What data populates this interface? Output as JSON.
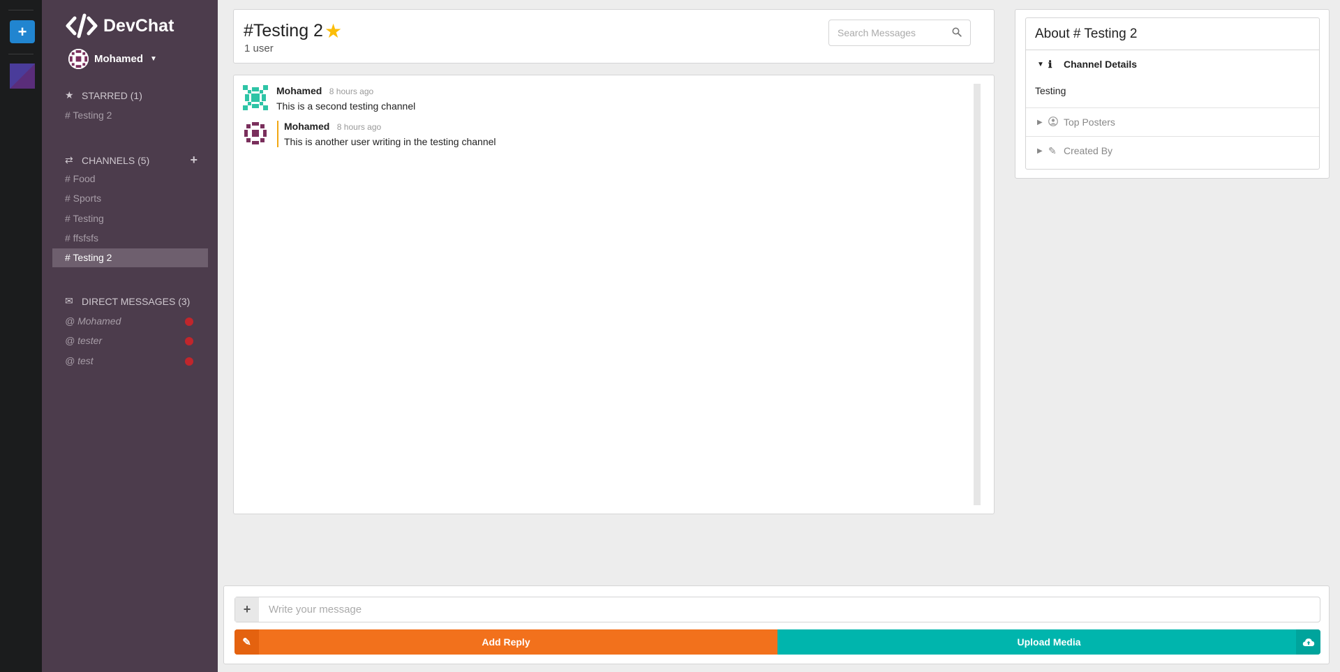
{
  "app": {
    "name": "DevChat"
  },
  "user": {
    "name": "Mohamed"
  },
  "starred": {
    "label": "STARRED (1)",
    "items": [
      {
        "label": "# Testing 2"
      }
    ]
  },
  "channels": {
    "label": "CHANNELS (5)",
    "items": [
      {
        "label": "# Food"
      },
      {
        "label": "# Sports"
      },
      {
        "label": "# Testing"
      },
      {
        "label": "# ffsfsfs"
      },
      {
        "label": "# Testing 2"
      }
    ]
  },
  "direct_messages": {
    "label": "DIRECT MESSAGES (3)",
    "items": [
      {
        "label": "@ Mohamed"
      },
      {
        "label": "@ tester"
      },
      {
        "label": "@ test"
      }
    ],
    "status_color": "#c0262c"
  },
  "header": {
    "channel_title": "#Testing 2",
    "user_count": "1 user",
    "search_placeholder": "Search Messages"
  },
  "messages": [
    {
      "author": "Mohamed",
      "time": "8 hours ago",
      "text": "This is a second testing channel"
    },
    {
      "author": "Mohamed",
      "time": "8 hours ago",
      "text": "This is another user writing in the testing channel"
    }
  ],
  "about": {
    "title": "About # Testing 2",
    "sections": [
      {
        "label": "Channel Details",
        "content": "Testing"
      },
      {
        "label": "Top Posters"
      },
      {
        "label": "Created By"
      }
    ]
  },
  "composer": {
    "placeholder": "Write your message",
    "reply_label": "Add Reply",
    "upload_label": "Upload Media"
  },
  "colors": {
    "sidebar": "#4c3c4c",
    "rail": "#1b1c1d",
    "add_button": "#2185d0",
    "reply_button": "#f2711c",
    "upload_button": "#00b5ad",
    "star": "#fbbd08"
  }
}
